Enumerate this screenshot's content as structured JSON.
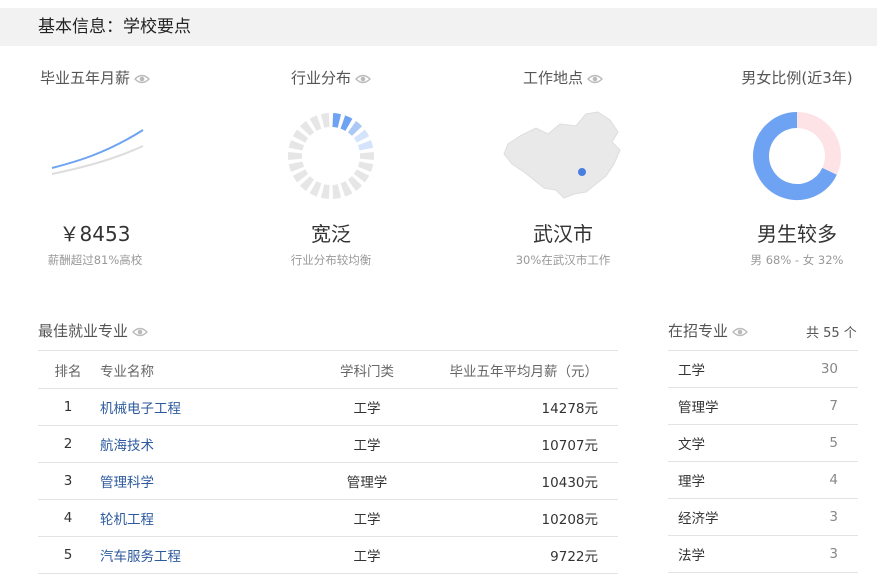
{
  "header": {
    "title": "基本信息：学校要点"
  },
  "salary_card": {
    "title": "毕业五年月薪",
    "value": "￥8453",
    "note": "薪酬超过81%高校"
  },
  "industry_card": {
    "title": "行业分布",
    "value": "宽泛",
    "note": "行业分布较均衡"
  },
  "location_card": {
    "title": "工作地点",
    "value": "武汉市",
    "note": "30%在武汉市工作"
  },
  "gender_card": {
    "title": "男女比例(近3年)",
    "value": "男生较多",
    "note": "男 68% - 女 32%",
    "male_percent": 68,
    "female_percent": 32
  },
  "best_majors": {
    "title": "最佳就业专业",
    "columns": [
      "排名",
      "专业名称",
      "学科门类",
      "毕业五年平均月薪（元）"
    ],
    "rows": [
      {
        "rank": "1",
        "name": "机械电子工程",
        "category": "工学",
        "salary": "14278元"
      },
      {
        "rank": "2",
        "name": "航海技术",
        "category": "工学",
        "salary": "10707元"
      },
      {
        "rank": "3",
        "name": "管理科学",
        "category": "管理学",
        "salary": "10430元"
      },
      {
        "rank": "4",
        "name": "轮机工程",
        "category": "工学",
        "salary": "10208元"
      },
      {
        "rank": "5",
        "name": "汽车服务工程",
        "category": "工学",
        "salary": "9722元"
      }
    ]
  },
  "enrolling_majors": {
    "title": "在招专业",
    "total": "共 55 个",
    "rows": [
      {
        "name": "工学",
        "count": "30"
      },
      {
        "name": "管理学",
        "count": "7"
      },
      {
        "name": "文学",
        "count": "5"
      },
      {
        "name": "理学",
        "count": "4"
      },
      {
        "name": "经济学",
        "count": "3"
      },
      {
        "name": "法学",
        "count": "3"
      }
    ]
  },
  "colors": {
    "accent_blue": "#6ea3f4",
    "light_blue": "#aac8f6",
    "pale_blue": "#d6e4fb",
    "pink": "#fde3e6",
    "gray": "#e6e6e6",
    "link": "#2d5a9e"
  },
  "icons": {
    "eye": "eye-icon",
    "map_marker": "location-dot-icon"
  }
}
